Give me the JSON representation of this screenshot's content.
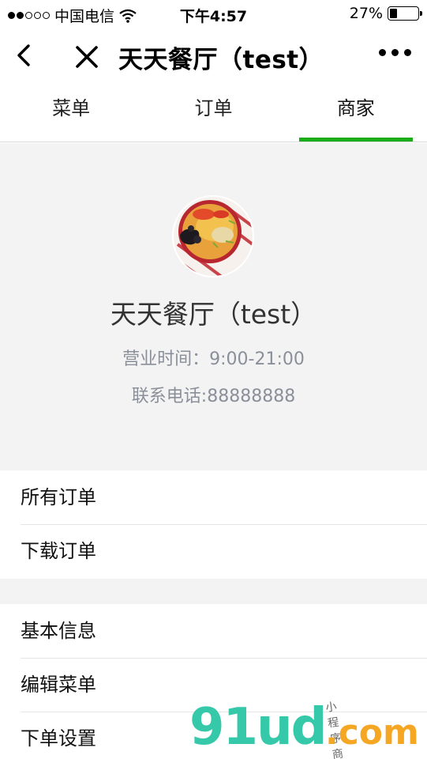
{
  "status_bar": {
    "carrier": "中国电信",
    "time": "下午4:57",
    "battery": "27%",
    "battery_level": 0.27,
    "signal_bars_filled": 2,
    "signal_bars_total": 5,
    "wifi_icon": "wifi-icon"
  },
  "nav": {
    "title": "天天餐厅（test）",
    "back_icon": "chevron-left-icon",
    "close_icon": "close-icon",
    "more_icon": "more-dots-icon"
  },
  "tabs": [
    {
      "label": "菜单",
      "active": false
    },
    {
      "label": "订单",
      "active": false
    },
    {
      "label": "商家",
      "active": true
    }
  ],
  "shop": {
    "name": "天天餐厅（test）",
    "hours": "营业时间：9:00-21:00",
    "phone": "联系电话:88888888"
  },
  "menu_group_1": [
    {
      "label": "所有订单"
    },
    {
      "label": "下载订单"
    }
  ],
  "menu_group_2": [
    {
      "label": "基本信息"
    },
    {
      "label": "编辑菜单"
    },
    {
      "label": "下单设置"
    }
  ],
  "watermark": {
    "main": "91ud",
    "suffix": ".com",
    "tag": "小程序商店"
  },
  "colors": {
    "accent": "#1aad19",
    "header_bg": "#f3f3f3",
    "muted_text": "#8a8f99"
  }
}
